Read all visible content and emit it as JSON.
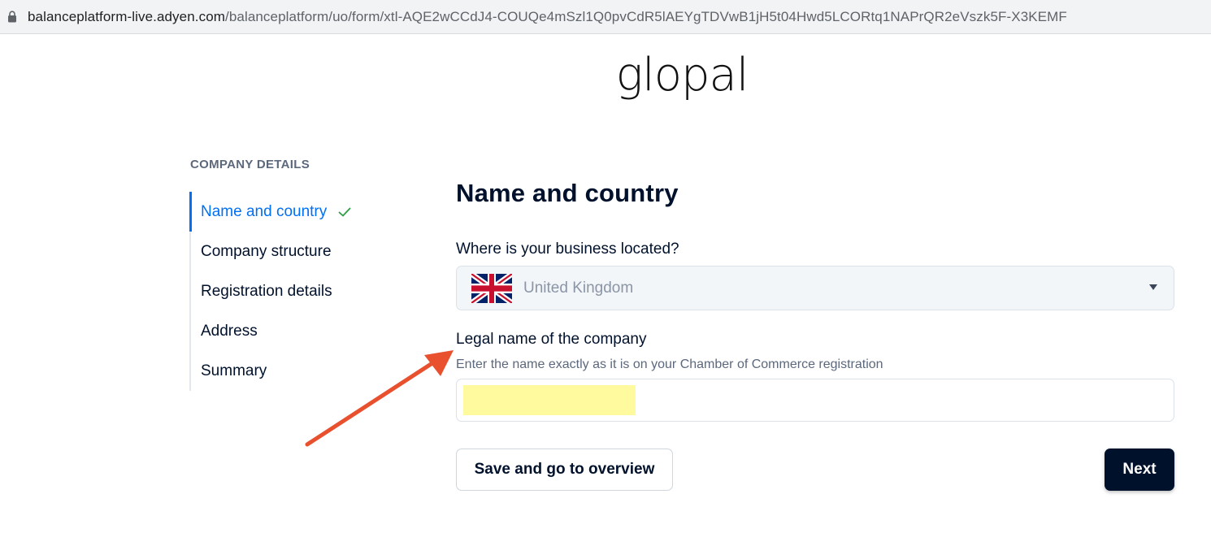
{
  "browser": {
    "url_host": "balanceplatform-live.adyen.com",
    "url_path": "/balanceplatform/uo/form/xtl-AQE2wCCdJ4-COUQe4mSzl1Q0pvCdR5lAEYgTDVwB1jH5t04Hwd5LCORtq1NAPrQR2eVszk5F-X3KEMF",
    "lock_icon": "lock-icon"
  },
  "logo": {
    "text": "glopal"
  },
  "sidebar": {
    "heading": "COMPANY DETAILS",
    "items": [
      {
        "label": "Name and country",
        "active": true,
        "completed": true
      },
      {
        "label": "Company structure",
        "active": false,
        "completed": false
      },
      {
        "label": "Registration details",
        "active": false,
        "completed": false
      },
      {
        "label": "Address",
        "active": false,
        "completed": false
      },
      {
        "label": "Summary",
        "active": false,
        "completed": false
      }
    ]
  },
  "main": {
    "title": "Name and country",
    "location_label": "Where is your business located?",
    "country": {
      "value": "United Kingdom",
      "flag_icon": "uk-flag-icon"
    },
    "legal_name_label": "Legal name of the company",
    "legal_name_helper": "Enter the name exactly as it is on your Chamber of Commerce registration",
    "legal_name_value": ""
  },
  "actions": {
    "save_label": "Save and go to overview",
    "next_label": "Next"
  },
  "colors": {
    "accent": "#0070f5",
    "primary_button": "#00112c",
    "check": "#2ea043",
    "annotation_arrow": "#e8502e",
    "highlight": "#fffa9e"
  }
}
